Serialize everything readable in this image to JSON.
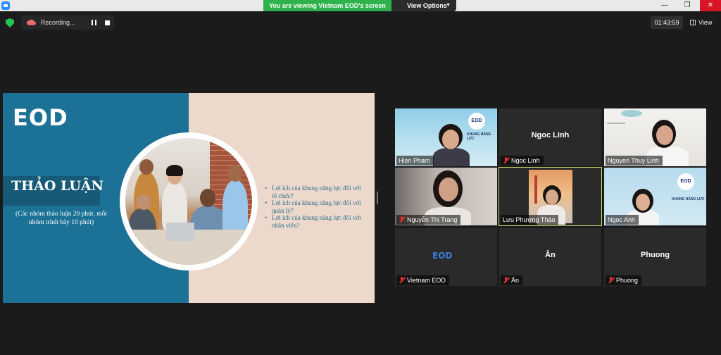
{
  "titlebar": {
    "banner": "You are viewing Vietnam EOD's screen",
    "view_options": "View Options",
    "minimize": "—",
    "restore": "❐",
    "close": "✕"
  },
  "toolbar": {
    "recording": "Recording...",
    "timer": "01:43:59",
    "view": "View"
  },
  "slide": {
    "logo": "EOD",
    "title": "THẢO LUẬN",
    "subtitle": "(Các nhóm thảo luận 20 phút, mỗi nhóm trình bày 10 phút)",
    "bullets": [
      "Lợi ích của khung năng lực đối với tổ chức?",
      "Lợi ích của khung năng lực đối với quản lý?",
      "Lợi ích của khung năng lực đối với nhân viên?"
    ]
  },
  "gallery": {
    "tiles": [
      {
        "name": "Hien Pham",
        "muted": false
      },
      {
        "name": "Ngoc Linh",
        "center": "Ngoc Linh",
        "muted": true
      },
      {
        "name": "Nguyen Thuy Linh",
        "muted": false
      },
      {
        "name": "Nguyễn Thị Trang",
        "muted": true
      },
      {
        "name": "Lưu Phương Thảo",
        "muted": false,
        "active": true
      },
      {
        "name": "Ngoc Anh",
        "muted": false
      },
      {
        "name": "Vietnam EOD",
        "muted": true,
        "logo": "EOD"
      },
      {
        "name": "Ân",
        "center": "Ân",
        "muted": true
      },
      {
        "name": "Phuong",
        "center": "Phuong",
        "muted": true
      }
    ]
  },
  "badge_text": "EOD",
  "khung_text": "KHUNG NĂNG LỰC",
  "colors": {
    "banner_green": "#2fb24c",
    "slide_blue": "#1c7196",
    "slide_peach": "#ecd9cc",
    "active_border": "#c9e265",
    "muted_red": "#e2322d"
  }
}
